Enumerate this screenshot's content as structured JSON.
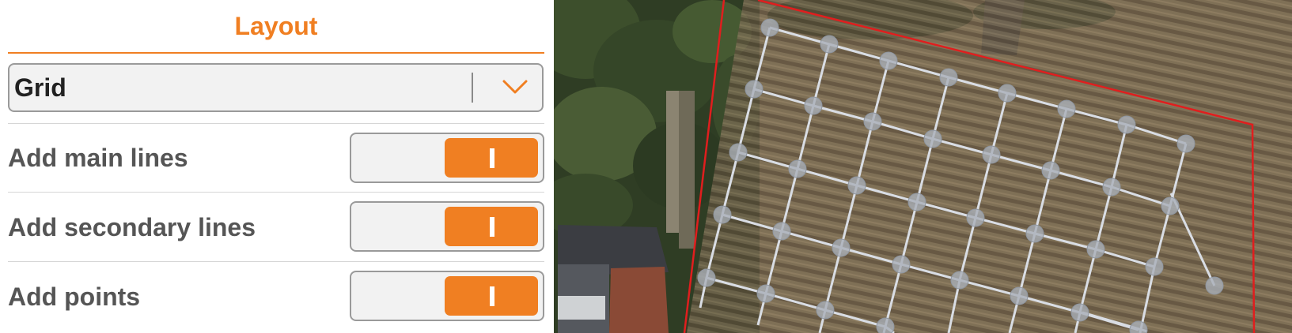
{
  "layout_panel": {
    "title": "Layout",
    "layout_type": {
      "selected": "Grid"
    },
    "options": [
      {
        "label": "Add main lines",
        "enabled": true
      },
      {
        "label": "Add secondary lines",
        "enabled": true
      },
      {
        "label": "Add points",
        "enabled": true
      }
    ]
  },
  "map": {
    "boundary_color": "#e01e1e",
    "grid_line_color": "#d9dde4",
    "point_color": "#a9afb8"
  },
  "colors": {
    "accent": "#f07f22",
    "divider": "#d6d6d6",
    "control_background": "#f2f2f2"
  }
}
